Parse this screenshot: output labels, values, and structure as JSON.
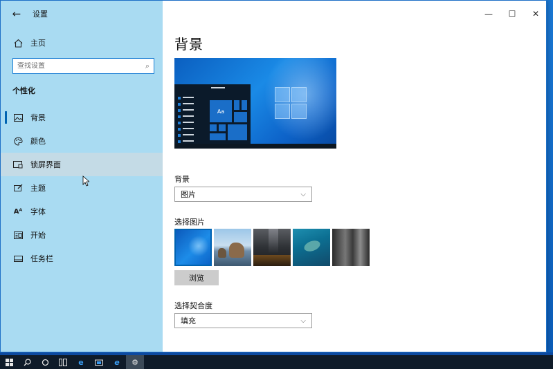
{
  "window": {
    "app_title": "设置",
    "controls": [
      "minimize-icon",
      "maximize-icon",
      "close-icon"
    ]
  },
  "sidebar": {
    "home_label": "主页",
    "search_placeholder": "查找设置",
    "section_title": "个性化",
    "items": [
      {
        "label": "背景",
        "icon": "picture-icon",
        "active": true
      },
      {
        "label": "颜色",
        "icon": "palette-icon"
      },
      {
        "label": "锁屏界面",
        "icon": "lock-screen-icon",
        "hover": true
      },
      {
        "label": "主题",
        "icon": "brush-icon"
      },
      {
        "label": "字体",
        "icon": "font-icon"
      },
      {
        "label": "开始",
        "icon": "start-icon"
      },
      {
        "label": "任务栏",
        "icon": "taskbar-icon"
      }
    ]
  },
  "main": {
    "page_title": "背景",
    "preview_sample_text": "Aa",
    "background_label": "背景",
    "background_value": "图片",
    "choose_picture_label": "选择图片",
    "browse_label": "浏览",
    "fit_label": "选择契合度",
    "fit_value": "填充"
  },
  "taskbar": {
    "icons": [
      "windows-start-icon",
      "search-icon",
      "cortana-icon",
      "task-view-icon",
      "edge-icon",
      "store-icon",
      "ie-icon",
      "settings-icon"
    ]
  },
  "colors": {
    "sidebar_bg": "#a9dbf2",
    "accent": "#0063b1",
    "taskbar_bg": "#0f1b29"
  }
}
